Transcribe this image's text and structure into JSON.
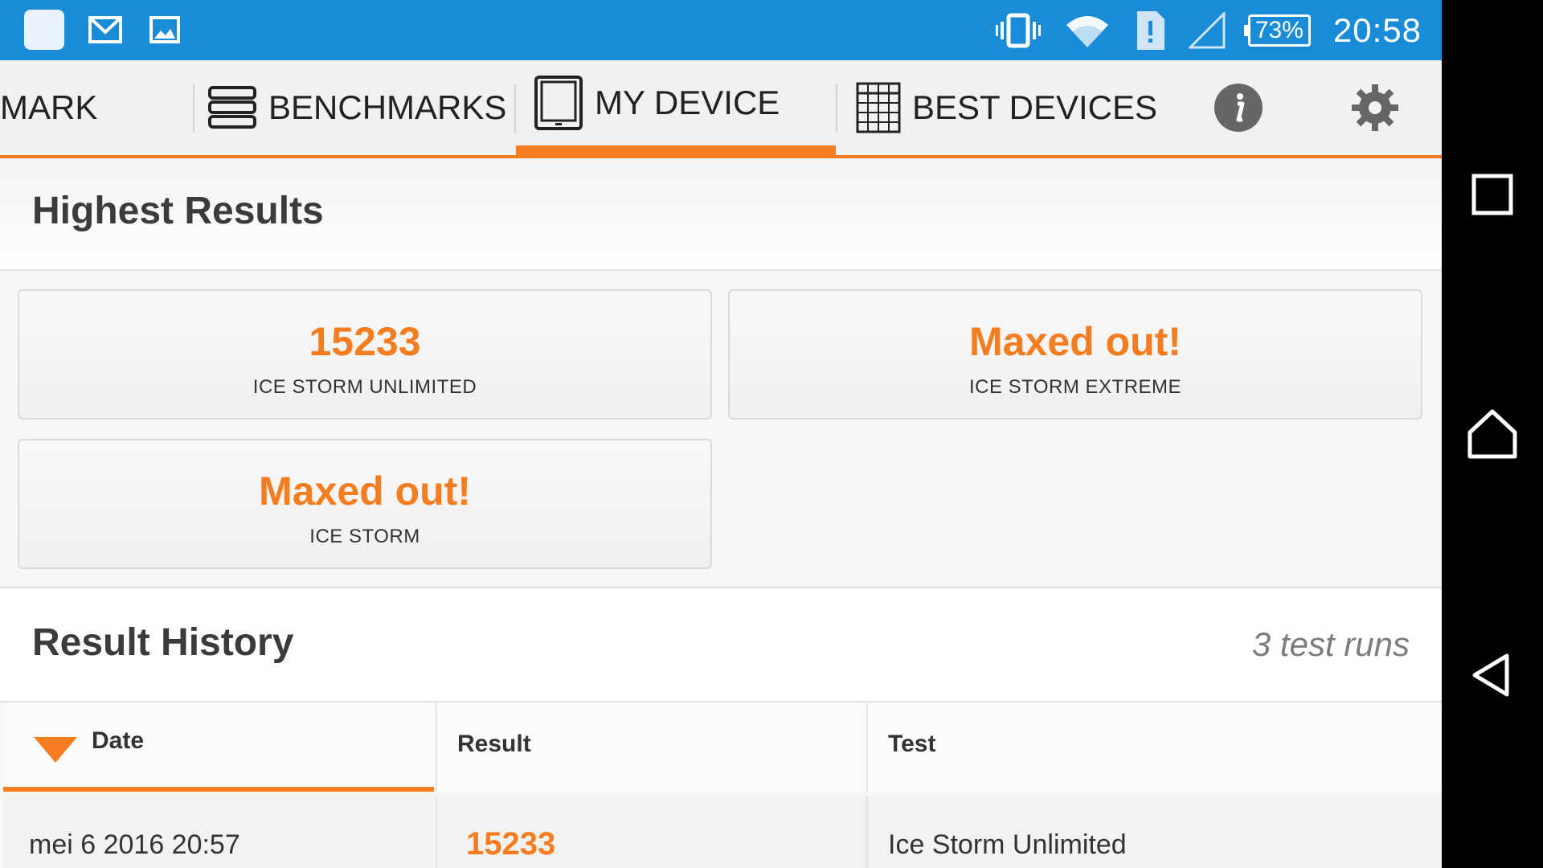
{
  "status_bar": {
    "battery": "73%",
    "time": "20:58"
  },
  "tabs": {
    "mark": "MARK",
    "benchmarks": "BENCHMARKS",
    "my_device": "MY DEVICE",
    "best_devices": "BEST DEVICES"
  },
  "highest_results": {
    "title": "Highest Results",
    "cards": [
      {
        "value": "15233",
        "name": "ICE STORM UNLIMITED"
      },
      {
        "value": "Maxed out!",
        "name": "ICE STORM EXTREME"
      },
      {
        "value": "Maxed out!",
        "name": "ICE STORM"
      }
    ]
  },
  "result_history": {
    "title": "Result History",
    "runs": "3 test runs",
    "columns": {
      "date": "Date",
      "result": "Result",
      "test": "Test"
    },
    "rows": [
      {
        "date": "mei 6 2016 20:57",
        "result": "15233",
        "test": "Ice Storm Unlimited"
      }
    ]
  },
  "colors": {
    "accent": "#f57c1f",
    "status_bar": "#1a8bd6"
  }
}
